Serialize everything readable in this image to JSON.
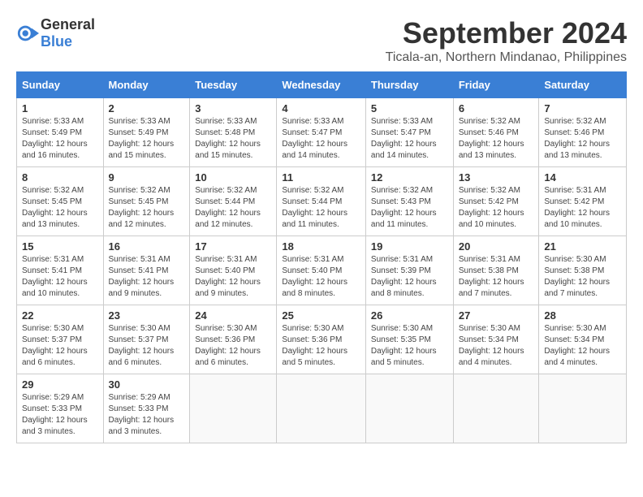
{
  "logo": {
    "general": "General",
    "blue": "Blue"
  },
  "header": {
    "month_year": "September 2024",
    "location": "Ticala-an, Northern Mindanao, Philippines"
  },
  "weekdays": [
    "Sunday",
    "Monday",
    "Tuesday",
    "Wednesday",
    "Thursday",
    "Friday",
    "Saturday"
  ],
  "weeks": [
    [
      {
        "day": "1",
        "sunrise": "5:33 AM",
        "sunset": "5:49 PM",
        "daylight": "12 hours and 16 minutes."
      },
      {
        "day": "2",
        "sunrise": "5:33 AM",
        "sunset": "5:49 PM",
        "daylight": "12 hours and 15 minutes."
      },
      {
        "day": "3",
        "sunrise": "5:33 AM",
        "sunset": "5:48 PM",
        "daylight": "12 hours and 15 minutes."
      },
      {
        "day": "4",
        "sunrise": "5:33 AM",
        "sunset": "5:47 PM",
        "daylight": "12 hours and 14 minutes."
      },
      {
        "day": "5",
        "sunrise": "5:33 AM",
        "sunset": "5:47 PM",
        "daylight": "12 hours and 14 minutes."
      },
      {
        "day": "6",
        "sunrise": "5:32 AM",
        "sunset": "5:46 PM",
        "daylight": "12 hours and 13 minutes."
      },
      {
        "day": "7",
        "sunrise": "5:32 AM",
        "sunset": "5:46 PM",
        "daylight": "12 hours and 13 minutes."
      }
    ],
    [
      {
        "day": "8",
        "sunrise": "5:32 AM",
        "sunset": "5:45 PM",
        "daylight": "12 hours and 13 minutes."
      },
      {
        "day": "9",
        "sunrise": "5:32 AM",
        "sunset": "5:45 PM",
        "daylight": "12 hours and 12 minutes."
      },
      {
        "day": "10",
        "sunrise": "5:32 AM",
        "sunset": "5:44 PM",
        "daylight": "12 hours and 12 minutes."
      },
      {
        "day": "11",
        "sunrise": "5:32 AM",
        "sunset": "5:44 PM",
        "daylight": "12 hours and 11 minutes."
      },
      {
        "day": "12",
        "sunrise": "5:32 AM",
        "sunset": "5:43 PM",
        "daylight": "12 hours and 11 minutes."
      },
      {
        "day": "13",
        "sunrise": "5:32 AM",
        "sunset": "5:42 PM",
        "daylight": "12 hours and 10 minutes."
      },
      {
        "day": "14",
        "sunrise": "5:31 AM",
        "sunset": "5:42 PM",
        "daylight": "12 hours and 10 minutes."
      }
    ],
    [
      {
        "day": "15",
        "sunrise": "5:31 AM",
        "sunset": "5:41 PM",
        "daylight": "12 hours and 10 minutes."
      },
      {
        "day": "16",
        "sunrise": "5:31 AM",
        "sunset": "5:41 PM",
        "daylight": "12 hours and 9 minutes."
      },
      {
        "day": "17",
        "sunrise": "5:31 AM",
        "sunset": "5:40 PM",
        "daylight": "12 hours and 9 minutes."
      },
      {
        "day": "18",
        "sunrise": "5:31 AM",
        "sunset": "5:40 PM",
        "daylight": "12 hours and 8 minutes."
      },
      {
        "day": "19",
        "sunrise": "5:31 AM",
        "sunset": "5:39 PM",
        "daylight": "12 hours and 8 minutes."
      },
      {
        "day": "20",
        "sunrise": "5:31 AM",
        "sunset": "5:38 PM",
        "daylight": "12 hours and 7 minutes."
      },
      {
        "day": "21",
        "sunrise": "5:30 AM",
        "sunset": "5:38 PM",
        "daylight": "12 hours and 7 minutes."
      }
    ],
    [
      {
        "day": "22",
        "sunrise": "5:30 AM",
        "sunset": "5:37 PM",
        "daylight": "12 hours and 6 minutes."
      },
      {
        "day": "23",
        "sunrise": "5:30 AM",
        "sunset": "5:37 PM",
        "daylight": "12 hours and 6 minutes."
      },
      {
        "day": "24",
        "sunrise": "5:30 AM",
        "sunset": "5:36 PM",
        "daylight": "12 hours and 6 minutes."
      },
      {
        "day": "25",
        "sunrise": "5:30 AM",
        "sunset": "5:36 PM",
        "daylight": "12 hours and 5 minutes."
      },
      {
        "day": "26",
        "sunrise": "5:30 AM",
        "sunset": "5:35 PM",
        "daylight": "12 hours and 5 minutes."
      },
      {
        "day": "27",
        "sunrise": "5:30 AM",
        "sunset": "5:34 PM",
        "daylight": "12 hours and 4 minutes."
      },
      {
        "day": "28",
        "sunrise": "5:30 AM",
        "sunset": "5:34 PM",
        "daylight": "12 hours and 4 minutes."
      }
    ],
    [
      {
        "day": "29",
        "sunrise": "5:29 AM",
        "sunset": "5:33 PM",
        "daylight": "12 hours and 3 minutes."
      },
      {
        "day": "30",
        "sunrise": "5:29 AM",
        "sunset": "5:33 PM",
        "daylight": "12 hours and 3 minutes."
      },
      null,
      null,
      null,
      null,
      null
    ]
  ]
}
